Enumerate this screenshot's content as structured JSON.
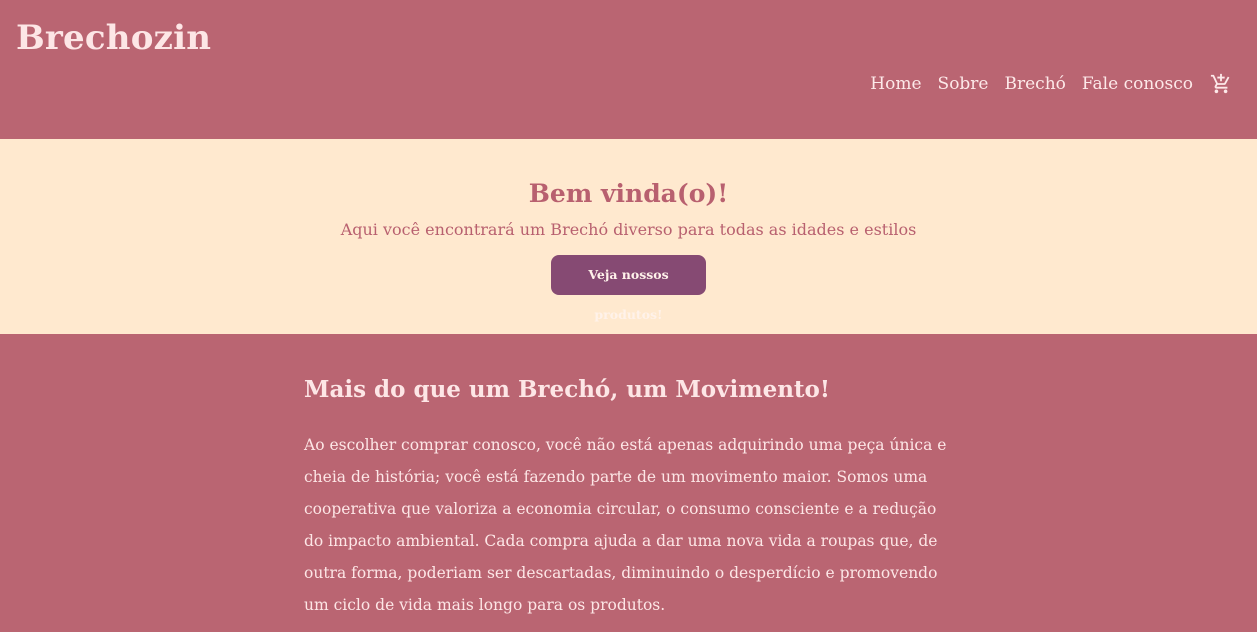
{
  "header": {
    "brand": "Brechozin",
    "nav": [
      {
        "label": "Home"
      },
      {
        "label": "Sobre"
      },
      {
        "label": "Brechó"
      },
      {
        "label": "Fale conosco"
      }
    ],
    "cart_icon": "add-shopping-cart-icon"
  },
  "hero": {
    "title": "Bem vinda(o)!",
    "subtitle": "Aqui você encontrará um Brechó diverso para todas as idades e estilos",
    "cta_label": "Veja nossos produtos!"
  },
  "about": {
    "title": "Mais do que um Brechó, um Movimento!",
    "body": "Ao escolher comprar conosco, você não está apenas adquirindo uma peça única e cheia de história; você está fazendo parte de um movimento maior. Somos uma cooperativa que valoriza a economia circular, o consumo consciente e a redução do impacto ambiental. Cada compra ajuda a dar uma nova vida a roupas que, de outra forma, poderiam ser descartadas, diminuindo o desperdício e promovendo um ciclo de vida mais longo para os produtos."
  },
  "colors": {
    "primary": "#ba6572",
    "hero_bg": "#ffe9cf",
    "button": "#864a73",
    "light_text": "#fde6e6"
  }
}
